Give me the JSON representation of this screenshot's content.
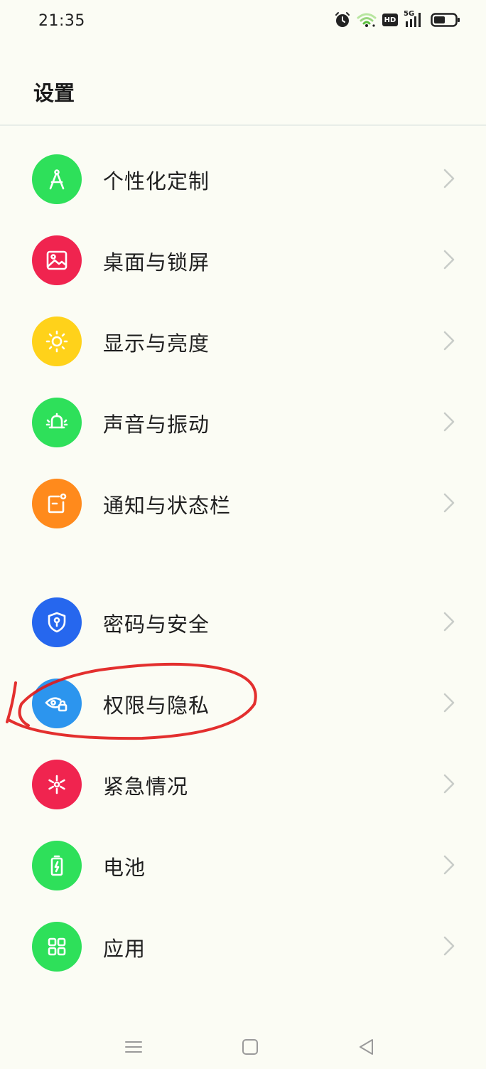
{
  "status_bar": {
    "time": "21:35",
    "icons": [
      "alarm-icon",
      "wifi-icon",
      "hd-icon",
      "5g-signal-icon",
      "battery-icon"
    ],
    "network_label": "5G",
    "hd_label": "HD"
  },
  "header": {
    "title": "设置"
  },
  "items": [
    {
      "label": "个性化定制",
      "icon": "compass-icon",
      "color": "#2ee05a"
    },
    {
      "label": "桌面与锁屏",
      "icon": "picture-icon",
      "color": "#f0244f"
    },
    {
      "label": "显示与亮度",
      "icon": "sun-icon",
      "color": "#ffd21a"
    },
    {
      "label": "声音与振动",
      "icon": "bell-icon",
      "color": "#2ee05a"
    },
    {
      "label": "通知与状态栏",
      "icon": "notification-icon",
      "color": "#ff8a1c"
    },
    {
      "label": "密码与安全",
      "icon": "shield-icon",
      "color": "#2667ee"
    },
    {
      "label": "权限与隐私",
      "icon": "eye-lock-icon",
      "color": "#2c95ee"
    },
    {
      "label": "紧急情况",
      "icon": "asterisk-icon",
      "color": "#f0244f"
    },
    {
      "label": "电池",
      "icon": "battery-charge-icon",
      "color": "#2ee05a"
    },
    {
      "label": "应用",
      "icon": "apps-grid-icon",
      "color": "#2ee05a"
    }
  ],
  "annotation_color": "#e01818",
  "nav_bar": [
    "menu-icon",
    "home-icon",
    "back-icon"
  ]
}
